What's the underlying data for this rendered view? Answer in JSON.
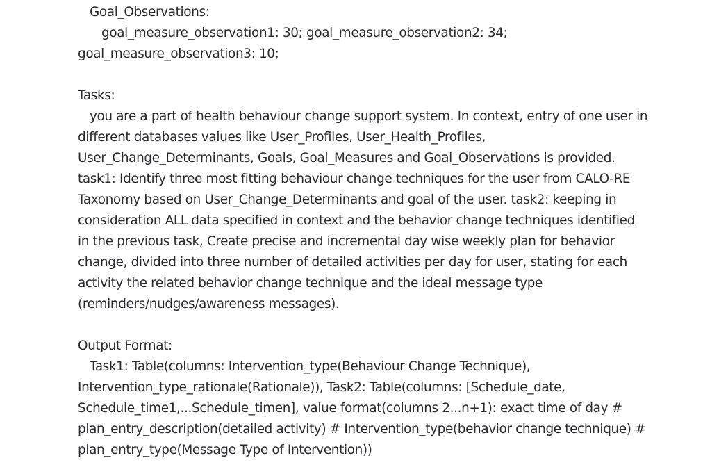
{
  "message": {
    "goal_observations": {
      "heading": "Goal_Observations:",
      "lines": [
        "goal_measure_observation1: 30; goal_measure_observation2: 34;",
        "goal_measure_observation3: 10;"
      ]
    },
    "tasks": {
      "heading": "Tasks:",
      "lines": [
        "you are a part of health behaviour change support system. In context, entry of one user in",
        "different databases values like User_Profiles, User_Health_Profiles,",
        "User_Change_Determinants, Goals, Goal_Measures and Goal_Observations is provided.",
        "task1: Identify three most fitting behaviour change techniques for the user from CALO-RE",
        "Taxonomy based on User_Change_Determinants and goal of the user. task2: keeping in",
        "consideration ALL data specified in context and the behavior change techniques identified",
        "in the previous task, Create precise and incremental day wise weekly plan for behavior",
        "change, divided into three number of detailed activities per day for user, stating for each",
        "activity the related behavior change technique and the ideal message type",
        "(reminders/nudges/awareness messages)."
      ]
    },
    "output_format": {
      "heading": "Output Format:",
      "lines": [
        "Task1: Table(columns: Intervention_type(Behaviour Change Technique),",
        "Intervention_type_rationale(Rationale)), Task2: Table(columns: [Schedule_date,",
        "Schedule_time1,...Schedule_timen], value format(columns 2...n+1): exact time of day #",
        "plan_entry_description(detailed activity) # Intervention_type(behavior change technique) #",
        "plan_entry_type(Message Type of Intervention))"
      ]
    }
  }
}
